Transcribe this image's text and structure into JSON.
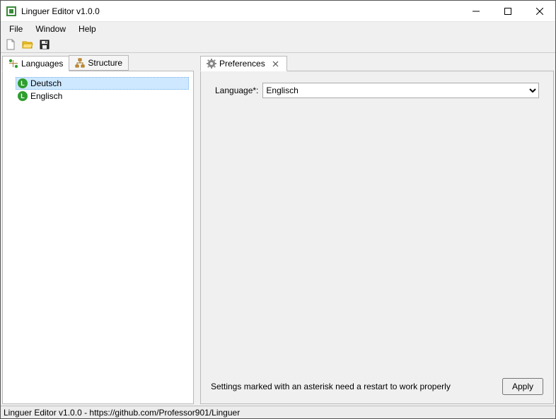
{
  "app": {
    "title": "Linguer Editor v1.0.0"
  },
  "menu": {
    "file": "File",
    "window": "Window",
    "help": "Help"
  },
  "toolbar": {
    "new_tip": "New",
    "open_tip": "Open",
    "save_tip": "Save"
  },
  "left": {
    "tabs": {
      "languages": "Languages",
      "structure": "Structure"
    },
    "items": [
      {
        "label": "Deutsch"
      },
      {
        "label": "Englisch"
      }
    ]
  },
  "right": {
    "tab": {
      "label": "Preferences"
    },
    "form": {
      "language_label": "Language*:",
      "language_value": "Englisch"
    },
    "note": "Settings marked with an asterisk need a restart to work properly",
    "apply": "Apply"
  },
  "statusbar": "Linguer Editor v1.0.0  -  https://github.com/Professor901/Linguer"
}
